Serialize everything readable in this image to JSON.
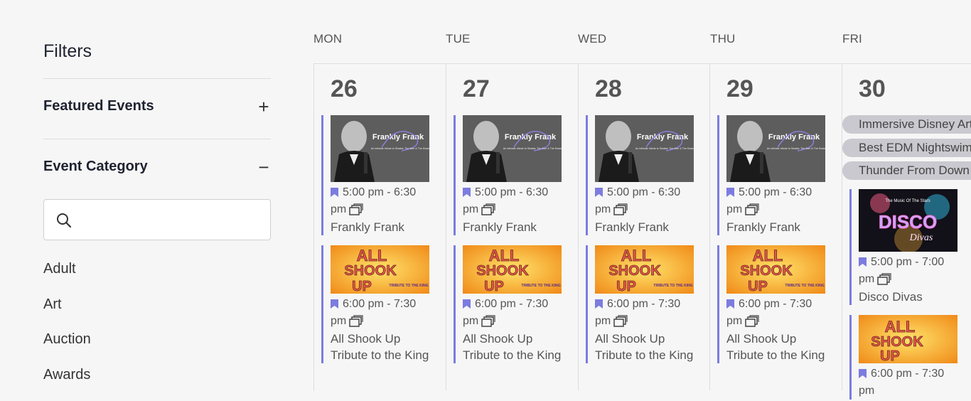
{
  "sidebar": {
    "title": "Filters",
    "featured": {
      "label": "Featured Events",
      "toggle": "+"
    },
    "category": {
      "label": "Event Category",
      "toggle": "−"
    },
    "search": {
      "placeholder": "",
      "value": ""
    },
    "categories": [
      "Adult",
      "Art",
      "Auction",
      "Awards"
    ]
  },
  "calendar": {
    "days": [
      {
        "name": "MON",
        "date": "26"
      },
      {
        "name": "TUE",
        "date": "27"
      },
      {
        "name": "WED",
        "date": "28"
      },
      {
        "name": "THU",
        "date": "29"
      },
      {
        "name": "FRI",
        "date": "30"
      }
    ],
    "events": {
      "frank": {
        "time": "5:00 pm - 6:30 pm",
        "title": "Frankly Frank",
        "image_text": "Frankly Frank",
        "image_sub": "An intimate tribute to Sinatra: The Man & The Music"
      },
      "shook": {
        "time": "6:00 pm - 7:30 pm",
        "title": "All Shook Up Tribute to the King",
        "image_text_1": "ALL",
        "image_text_2": "SHOOK",
        "image_text_3": "UP",
        "image_tag": "TRIBUTE TO THE KING"
      }
    },
    "friday": {
      "pills": [
        "Immersive Disney Art",
        "Best EDM Nightswim",
        "Thunder From Down Under"
      ],
      "disco": {
        "time": "5:00 pm - 7:00 pm",
        "title": "Disco Divas",
        "image_text": "DISCO",
        "image_script": "Divas",
        "image_top": "The Music Of The Stars"
      },
      "shook_time": "6:00 pm - 7:30 pm"
    }
  },
  "colors": {
    "accent": "#7c7ce0",
    "pill": "#c9c9cf",
    "bg": "#f6f6f6"
  }
}
